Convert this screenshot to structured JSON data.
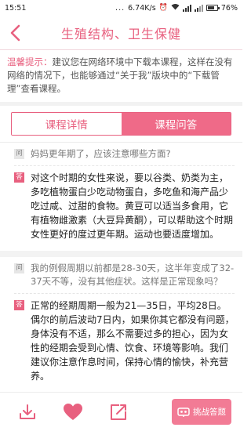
{
  "status": {
    "time": "15:51",
    "network_speed": "6.74K/s",
    "battery": "76%",
    "battery_level": 0.76
  },
  "header": {
    "title": "生殖结构、卫生保健"
  },
  "tip": {
    "label": "温馨提示：",
    "text": "建议您在网络环境中下载本课程，这样在没有网络的情况下，也能够通过“关于我”版块中的“下载管理”查看课程。"
  },
  "tabs": [
    {
      "label": "课程详情",
      "active": false
    },
    {
      "label": "课程问答",
      "active": true
    }
  ],
  "qa": [
    {
      "q_badge": "问",
      "question": "妈妈更年期了，应该注意哪些方面?",
      "a_badge": "答",
      "answer": "对这个时期的女性来说，要以谷类、奶类为主，多吃植物蛋白少吃动物蛋白，多吃鱼和海产品少吃过咸、过甜的食物。黄豆可以适当多食用，它有植物雌激素（大豆异黄酮），可以帮助这个时期女性更好的度过更年期。运动也要适度增加。"
    },
    {
      "q_badge": "问",
      "question": "我的例假周期以前都是28-30天，这半年变成了32-37天不等，没有其他症状。这样是正常现象吗？",
      "a_badge": "答",
      "answer": "正常的经期周期一般为21—35日，平均28日。偶尔的前后波动7日内，如果你其它都没有问题，身体没有不适，那么不需要过多的担心，因为女性的经期会受到心情、饮食、环境等影响。我们建议你注意作息时间，保持心情的愉快，补充营养。"
    }
  ],
  "toolbar": {
    "challenge_label": "挑战答题"
  },
  "colors": {
    "accent": "#e8607f",
    "tab_active_bg": "#ef6a88",
    "challenge_bg": "#f27b95"
  }
}
